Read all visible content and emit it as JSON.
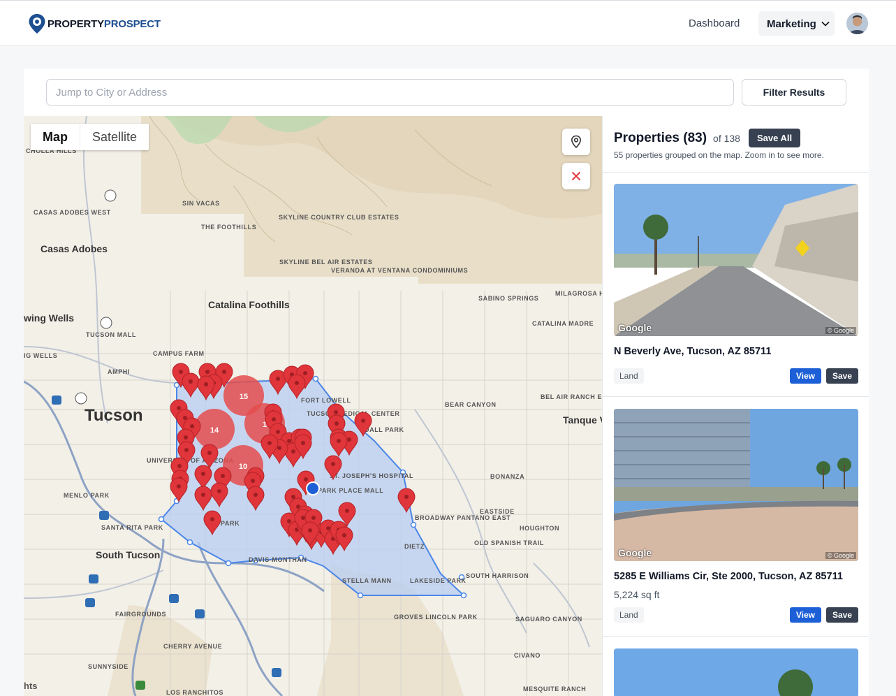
{
  "brand": {
    "part1": "PROPERTY",
    "part2": "PROSPECT"
  },
  "nav": {
    "dashboard": "Dashboard",
    "marketing": "Marketing"
  },
  "search": {
    "placeholder": "Jump to City or Address",
    "filter_label": "Filter Results"
  },
  "map": {
    "tab_map": "Map",
    "tab_satellite": "Satellite",
    "cluster_labels": [
      "15",
      "14",
      "1",
      "10"
    ],
    "labels_big": [
      "Tucson",
      "Casas Adobes",
      "Catalina Foothills",
      "South Tucson",
      "wing Wells",
      "Tanque V"
    ],
    "labels_small": [
      "CHOLLA HILLS",
      "SIN VACAS",
      "THE FOOTHILLS",
      "SKYLINE COUNTRY CLUB ESTATES",
      "SKYLINE BEL AIR ESTATES",
      "VERANDA AT VENTANA CONDOMINIUMS",
      "SABINO SPRINGS",
      "MILAGROSA H",
      "CATALINA MADRE",
      "TUCSON MALL",
      "CAMPUS FARM",
      "AMPHI",
      "BEAR CANYON",
      "BEL AIR RANCH ESTATES",
      "BONANZA",
      "EASTSIDE",
      "HOUGHTON",
      "BROADWAY PANTANO EAST",
      "OLD SPANISH TRAIL",
      "DIETZ",
      "SOUTH HARRISON",
      "LAKESIDE PARK",
      "STELLA MANN",
      "GROVES LINCOLN PARK",
      "SAGUARO CANYON",
      "CIVANO",
      "FAIRGROUNDS",
      "CHERRY AVENUE",
      "SUNNYSIDE",
      "SANTA RITA PARK",
      "MENLO PARK",
      "LOS RANCHITOS",
      "MESQUITE RANCH",
      "ST. JOSEPH'S HOSPITAL",
      "TUCSON MEDICAL CENTER",
      "DAVIS-MONTHAN",
      "PARK PLACE MALL",
      "PARK",
      "UNIVERSITY OF ARIZONA",
      "CASAS ADOBES WEST",
      "FORT LOWELL",
      "DALL PARK",
      "IG WELLS",
      "hts"
    ]
  },
  "sidebar": {
    "title": "Properties (83)",
    "of_total": "of 138",
    "save_all": "Save All",
    "subtitle": "55 properties grouped on the map. Zoom in to see more.",
    "photo_watermark": "Google",
    "photo_copyright": "© Google",
    "cards": [
      {
        "address": "N Beverly Ave, Tucson, AZ 85711",
        "sqft": "",
        "tag": "Land",
        "view": "View",
        "save": "Save"
      },
      {
        "address": "5285 E Williams Cir, Ste 2000, Tucson, AZ 85711",
        "sqft": "5,224 sq ft",
        "tag": "Land",
        "view": "View",
        "save": "Save"
      }
    ]
  },
  "colors": {
    "accent": "#1d5fd6",
    "marker": "#e0353a",
    "polygon_fill": "#c9d8f6",
    "polygon_stroke": "#4a86e8",
    "dark_button": "#374151"
  }
}
